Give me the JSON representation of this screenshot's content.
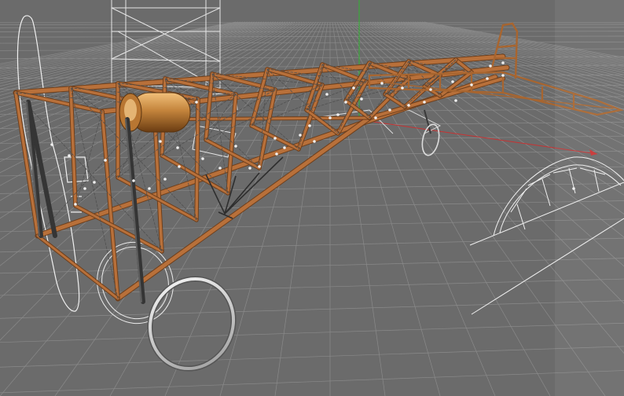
{
  "viewport": {
    "view": "perspective-3d-viewport",
    "scene_object": "aircraft-fuselage-frame-model"
  },
  "colors": {
    "background": "#6b6b6b",
    "grid_line": "#8a8a8a",
    "frame_wood": "#b8703a",
    "frame_wood_dark": "#6e3f1c",
    "strut_dark": "#3a3a3a",
    "fuel_tank": "#c4843c",
    "wireframe": "#e8e8e8",
    "x_axis": "#c83232",
    "y_axis": "#32b432",
    "vertex_dot": "#f0f0f0"
  },
  "icons": [
    "axis-x-line",
    "axis-y-line"
  ]
}
